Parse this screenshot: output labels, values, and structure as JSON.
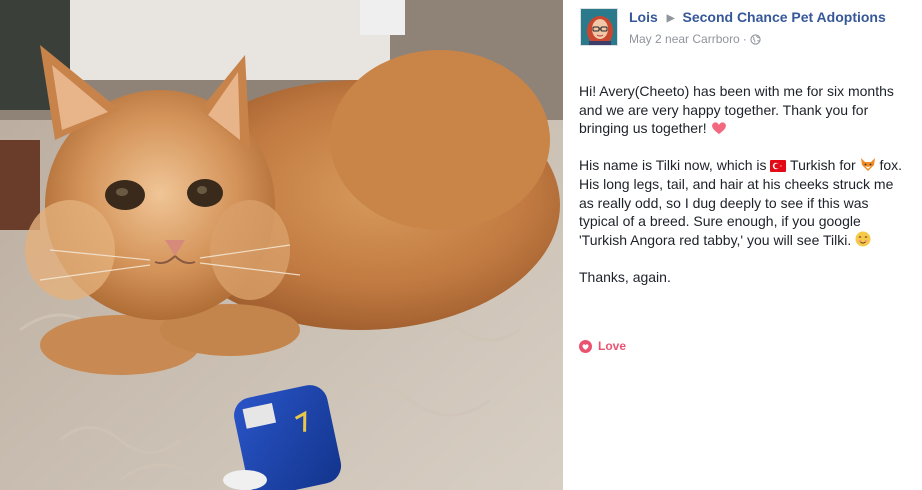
{
  "post": {
    "author": "Lois",
    "group": "Second Chance Pet Adoptions",
    "date": "May 2",
    "location": "near Carrboro",
    "separator": "·",
    "paragraph1": "Hi! Avery(Cheeto) has been with me for six months and we are very happy together. Thank you for bringing us together!",
    "paragraph2_a": "His name is Tilki now, which is",
    "paragraph2_b": "Turkish for",
    "paragraph2_c": "fox. His long legs, tail, and hair at his cheeks struck me as really odd, so I dug deeply to see if this was typical of a breed. Sure enough, if you google 'Turkish Angora red tabby,' you will see Tilki.",
    "paragraph3": "Thanks, again."
  },
  "reaction": {
    "label": "Love"
  },
  "icons": {
    "heart": "heart-emoji",
    "flag": "turkey-flag-emoji",
    "fox": "fox-emoji",
    "smile": "smiling-face-emoji",
    "privacy": "globe-icon",
    "reaction": "love-icon"
  },
  "colors": {
    "link": "#365899",
    "meta": "#90949c",
    "text": "#1d2129",
    "love": "#e9536f"
  }
}
